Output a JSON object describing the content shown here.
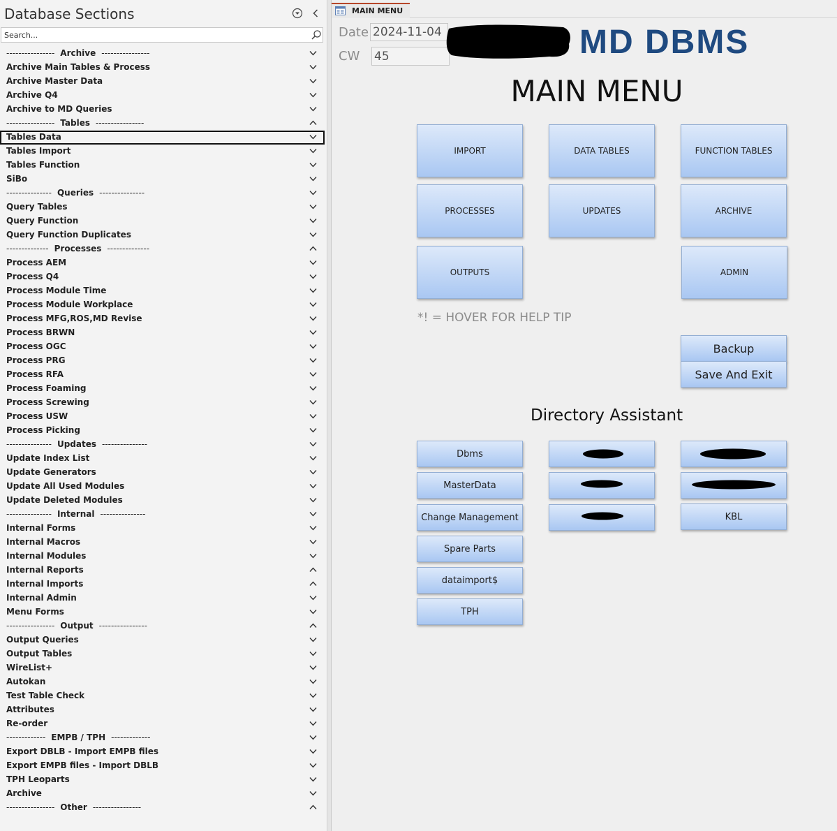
{
  "nav": {
    "title": "Database Sections",
    "search_placeholder": "Search...",
    "items": [
      {
        "label": "Archive",
        "sep": true,
        "dl": "----------------",
        "dr": "----------------",
        "chev": "down"
      },
      {
        "label": "Archive Main Tables & Process",
        "chev": "down"
      },
      {
        "label": "Archive Master Data",
        "chev": "down"
      },
      {
        "label": "Archive Q4",
        "chev": "down"
      },
      {
        "label": "Archive to MD Queries",
        "chev": "down"
      },
      {
        "label": "Tables",
        "sep": true,
        "dl": "----------------",
        "dr": "----------------",
        "chev": "up"
      },
      {
        "label": "Tables Data",
        "chev": "down",
        "selected": true
      },
      {
        "label": "Tables Import",
        "chev": "down"
      },
      {
        "label": "Tables Function",
        "chev": "down"
      },
      {
        "label": "SiBo",
        "chev": "down"
      },
      {
        "label": "Queries",
        "sep": true,
        "dl": "---------------",
        "dr": "---------------",
        "chev": "down"
      },
      {
        "label": "Query Tables",
        "chev": "down"
      },
      {
        "label": "Query Function",
        "chev": "down"
      },
      {
        "label": "Query Function Duplicates",
        "chev": "down"
      },
      {
        "label": "Processes",
        "sep": true,
        "dl": "--------------",
        "dr": "--------------",
        "chev": "up"
      },
      {
        "label": "Process AEM",
        "chev": "down"
      },
      {
        "label": "Process Q4",
        "chev": "down"
      },
      {
        "label": "Process Module Time",
        "chev": "down"
      },
      {
        "label": "Process Module Workplace",
        "chev": "down"
      },
      {
        "label": "Process MFG,ROS,MD Revise",
        "chev": "down"
      },
      {
        "label": "Process BRWN",
        "chev": "down"
      },
      {
        "label": "Process OGC",
        "chev": "down"
      },
      {
        "label": "Process PRG",
        "chev": "down"
      },
      {
        "label": "Process RFA",
        "chev": "down"
      },
      {
        "label": "Process Foaming",
        "chev": "down"
      },
      {
        "label": "Process Screwing",
        "chev": "down"
      },
      {
        "label": "Process USW",
        "chev": "down"
      },
      {
        "label": "Process Picking",
        "chev": "down"
      },
      {
        "label": "Updates",
        "sep": true,
        "dl": "---------------",
        "dr": "---------------",
        "chev": "down"
      },
      {
        "label": "Update Index List",
        "chev": "down"
      },
      {
        "label": "Update Generators",
        "chev": "down"
      },
      {
        "label": "Update All Used Modules",
        "chev": "down"
      },
      {
        "label": "Update Deleted Modules",
        "chev": "down"
      },
      {
        "label": "Internal",
        "sep": true,
        "dl": "---------------",
        "dr": "---------------",
        "chev": "down"
      },
      {
        "label": "Internal Forms",
        "chev": "down"
      },
      {
        "label": "Internal Macros",
        "chev": "down"
      },
      {
        "label": "Internal Modules",
        "chev": "down"
      },
      {
        "label": "Internal Reports",
        "chev": "up"
      },
      {
        "label": "Internal Imports",
        "chev": "up"
      },
      {
        "label": "Internal Admin",
        "chev": "down"
      },
      {
        "label": "Menu Forms",
        "chev": "down"
      },
      {
        "label": "Output",
        "sep": true,
        "dl": "----------------",
        "dr": "----------------",
        "chev": "up"
      },
      {
        "label": "Output Queries",
        "chev": "down"
      },
      {
        "label": "Output Tables",
        "chev": "down"
      },
      {
        "label": "WireList+",
        "chev": "down"
      },
      {
        "label": "Autokan",
        "chev": "down"
      },
      {
        "label": "Test Table Check",
        "chev": "down"
      },
      {
        "label": "Attributes",
        "chev": "down"
      },
      {
        "label": "Re-order",
        "chev": "down"
      },
      {
        "label": "EMPB / TPH",
        "sep": true,
        "dl": "-------------",
        "dr": "-------------",
        "chev": "down"
      },
      {
        "label": "Export DBLB - Import EMPB files",
        "chev": "down"
      },
      {
        "label": "Export EMPB files - Import DBLB",
        "chev": "down"
      },
      {
        "label": "TPH Leoparts",
        "chev": "down"
      },
      {
        "label": "Archive",
        "chev": "down"
      },
      {
        "label": "Other",
        "sep": true,
        "dl": "----------------",
        "dr": "----------------",
        "chev": "up"
      }
    ]
  },
  "tab": {
    "label": "MAIN MENU"
  },
  "form": {
    "date_label": "Date",
    "date_value": "2024-11-04",
    "cw_label": "CW",
    "cw_value": "45",
    "app_title": "MD DBMS",
    "heading": "MAIN MENU",
    "help_tip": "*! = HOVER FOR HELP TIP",
    "directory_heading": "Directory Assistant"
  },
  "menu_buttons": {
    "import": "IMPORT",
    "data_tables": "DATA TABLES",
    "function_tables": "FUNCTION TABLES",
    "processes": "PROCESSES",
    "updates": "UPDATES",
    "archive": "ARCHIVE",
    "outputs": "OUTPUTS",
    "admin": "ADMIN"
  },
  "util_buttons": {
    "backup": "Backup",
    "save_exit": "Save And Exit"
  },
  "dir_buttons": {
    "dbms": "Dbms",
    "masterdata": "MasterData",
    "change_management": "Change Management",
    "spare_parts": "Spare Parts",
    "dataimport": "dataimport$",
    "tph": "TPH",
    "kbl": "KBL"
  },
  "colors": {
    "title": "#1f4a80",
    "button_top": "#dde9fa",
    "button_bottom": "#a9c7f2",
    "tab_accent": "#b7472a"
  }
}
